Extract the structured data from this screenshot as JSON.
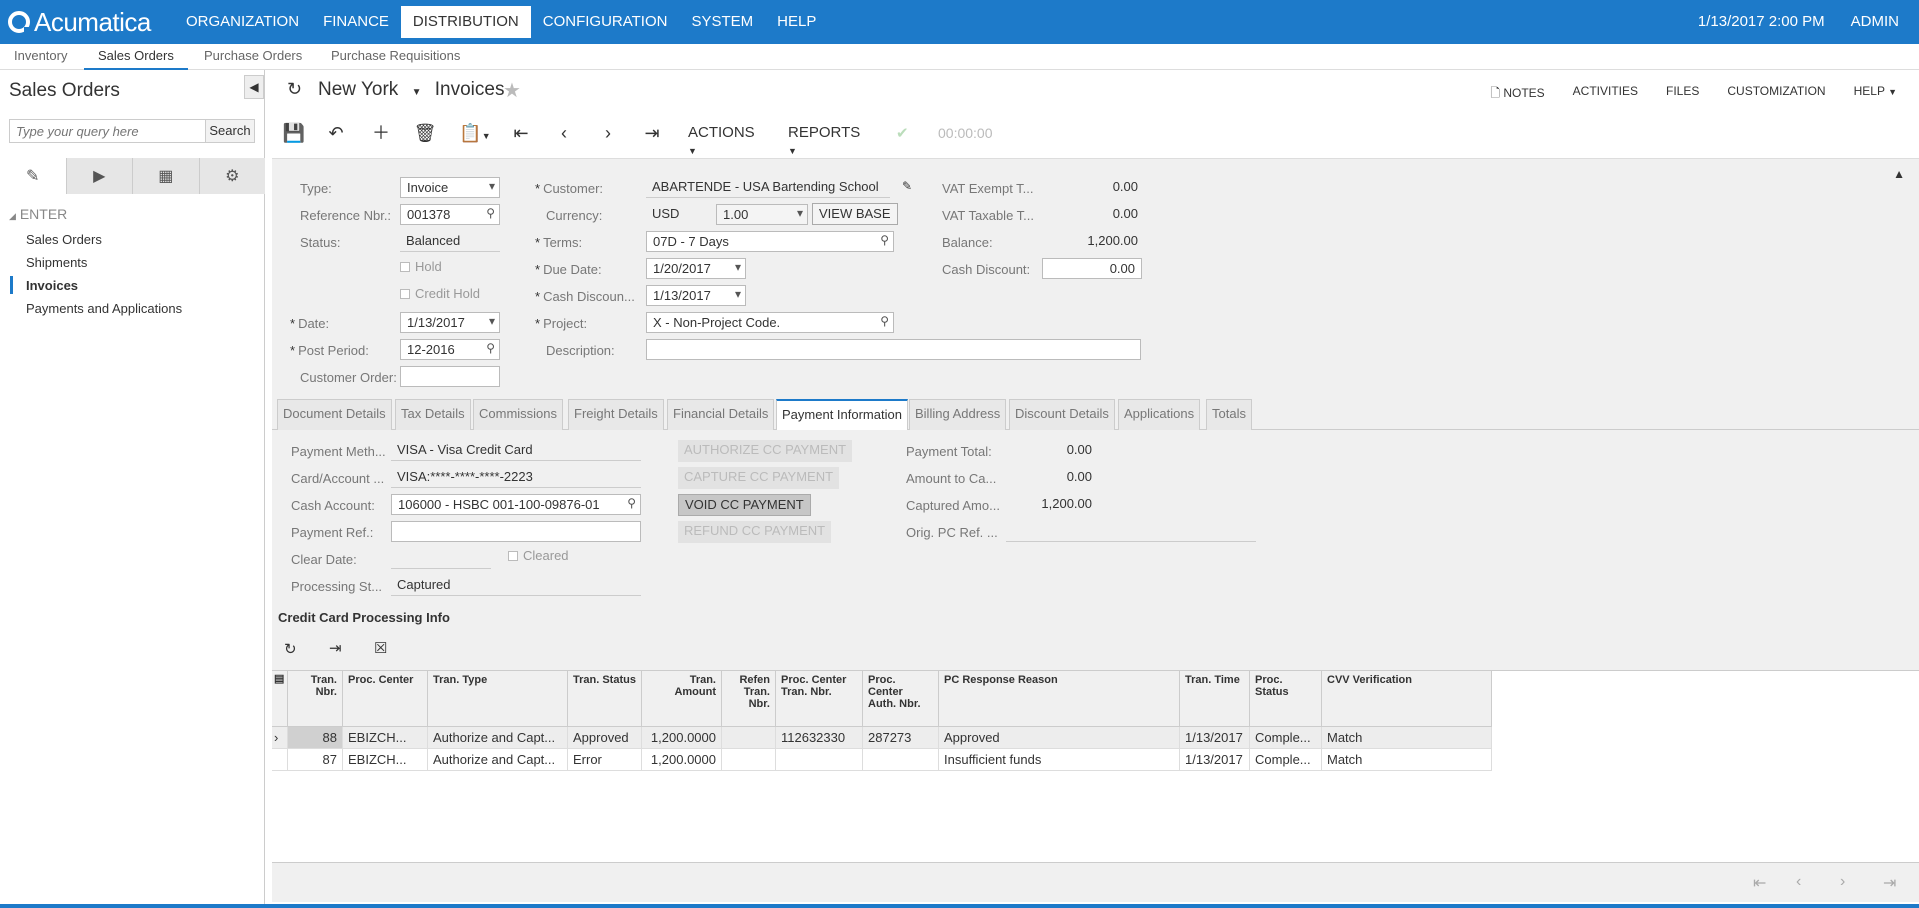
{
  "topbar": {
    "logo": "Acumatica",
    "nav": [
      "ORGANIZATION",
      "FINANCE",
      "DISTRIBUTION",
      "CONFIGURATION",
      "SYSTEM",
      "HELP"
    ],
    "datetime": "1/13/2017  2:00 PM",
    "user": "ADMIN"
  },
  "modules": [
    "Inventory",
    "Sales Orders",
    "Purchase Orders",
    "Purchase Requisitions"
  ],
  "sidebar": {
    "title": "Sales Orders",
    "search_placeholder": "Type your query here",
    "search_button": "Search",
    "section": "ENTER",
    "links": [
      "Sales Orders",
      "Shipments",
      "Invoices",
      "Payments and Applications"
    ]
  },
  "header": {
    "branch": "New York",
    "screen": "Invoices",
    "links": [
      "NOTES",
      "ACTIVITIES",
      "FILES",
      "CUSTOMIZATION",
      "HELP"
    ]
  },
  "toolbar": {
    "actions": "ACTIONS",
    "reports": "REPORTS",
    "timer": "00:00:00"
  },
  "form": {
    "type_label": "Type:",
    "type": "Invoice",
    "refnbr_label": "Reference Nbr.:",
    "refnbr": "001378",
    "status_label": "Status:",
    "status": "Balanced",
    "hold_label": "Hold",
    "credit_hold_label": "Credit Hold",
    "date_label": "Date:",
    "date": "1/13/2017",
    "post_period_label": "Post Period:",
    "post_period": "12-2016",
    "customer_order_label": "Customer Order:",
    "customer_order": "",
    "customer_label": "Customer:",
    "customer": "ABARTENDE - USA Bartending School",
    "currency_label": "Currency:",
    "currency": "USD",
    "rate": "1.00",
    "view_base": "VIEW BASE",
    "terms_label": "Terms:",
    "terms": "07D - 7 Days",
    "due_date_label": "Due Date:",
    "due_date": "1/20/2017",
    "cash_discount_date_label": "Cash Discoun...",
    "cash_discount_date": "1/13/2017",
    "project_label": "Project:",
    "project": "X - Non-Project Code.",
    "description_label": "Description:",
    "description": "",
    "vat_exempt_label": "VAT Exempt T...",
    "vat_exempt": "0.00",
    "vat_taxable_label": "VAT Taxable T...",
    "vat_taxable": "0.00",
    "balance_label": "Balance:",
    "balance": "1,200.00",
    "cash_discount_label": "Cash Discount:",
    "cash_discount": "0.00"
  },
  "tabs": [
    "Document Details",
    "Tax Details",
    "Commissions",
    "Freight Details",
    "Financial Details",
    "Payment Information",
    "Billing Address",
    "Discount Details",
    "Applications",
    "Totals"
  ],
  "payment": {
    "method_label": "Payment Meth...",
    "method": "VISA - Visa Credit Card",
    "card_label": "Card/Account ...",
    "card": "VISA:****-****-****-2223",
    "cash_account_label": "Cash Account:",
    "cash_account": "106000 - HSBC 001-100-09876-01",
    "ref_label": "Payment Ref.:",
    "ref": "",
    "clear_date_label": "Clear Date:",
    "clear_date": "",
    "cleared_label": "Cleared",
    "proc_status_label": "Processing St...",
    "proc_status": "Captured",
    "buttons": [
      "AUTHORIZE CC PAYMENT",
      "CAPTURE CC PAYMENT",
      "VOID CC PAYMENT",
      "REFUND CC PAYMENT"
    ],
    "total_label": "Payment Total:",
    "total": "0.00",
    "amount_label": "Amount to Ca...",
    "amount": "0.00",
    "captured_label": "Captured Amo...",
    "captured": "1,200.00",
    "orig_ref_label": "Orig. PC Ref. ...",
    "orig_ref": ""
  },
  "cc_info": {
    "title": "Credit Card Processing Info",
    "columns": [
      "Tran. Nbr.",
      "Proc. Center",
      "Tran. Type",
      "Tran. Status",
      "Tran. Amount",
      "Refen Tran. Nbr.",
      "Proc. Center Tran. Nbr.",
      "Proc. Center Auth. Nbr.",
      "PC Response Reason",
      "Tran. Time",
      "Proc. Status",
      "CVV Verification"
    ],
    "rows": [
      [
        "88",
        "EBIZCH...",
        "Authorize and Capt...",
        "Approved",
        "1,200.0000",
        "",
        "112632330",
        "287273",
        "Approved",
        "1/13/2017",
        "Comple...",
        "Match"
      ],
      [
        "87",
        "EBIZCH...",
        "Authorize and Capt...",
        "Error",
        "1,200.0000",
        "",
        "",
        "",
        "Insufficient funds",
        "1/13/2017",
        "Comple...",
        "Match"
      ]
    ]
  },
  "colors": {
    "brand": "#1d7ac9"
  }
}
